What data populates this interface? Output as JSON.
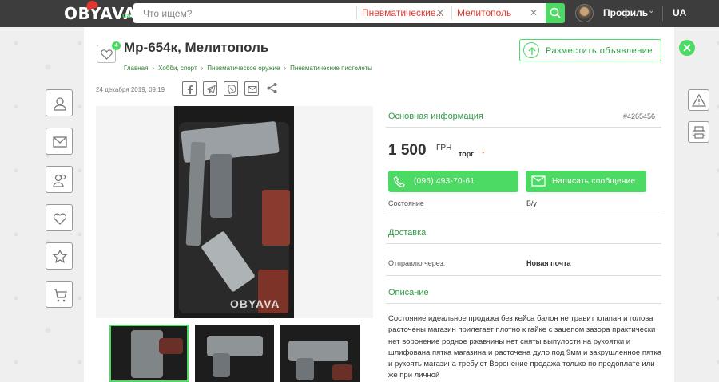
{
  "header": {
    "logo_text": "OBYAVA",
    "logo_sup": ".ua",
    "search": {
      "placeholder": "Что ищем?",
      "value": ""
    },
    "filter_category": "Пневматические...",
    "filter_city": "Мелитополь",
    "profile_label": "Профиль",
    "language": "UA"
  },
  "listing": {
    "title": "Мр-654к, Мелитополь",
    "favorites_count": "4",
    "breadcrumb": [
      "Главная",
      "Хобби, спорт",
      "Пневматическое оружие",
      "Пневматические пистолеты"
    ],
    "date": "24 декабря 2019, 09:19",
    "post_ad_label": "Разместить объявление",
    "photo_watermark": "OBYAVA"
  },
  "info": {
    "main_heading": "Основная информация",
    "ad_id": "#4265456",
    "price": "1 500",
    "currency": "ГРН",
    "trade": "торг",
    "phone": "(096) 493-70-61",
    "message_label": "Написать сообщение",
    "condition_label": "Состояние",
    "condition_value": "Б/у",
    "delivery_heading": "Доставка",
    "ship_via_label": "Отправлю через:",
    "ship_via_value": "Новая почта",
    "description_heading": "Описание",
    "description": "Состояние идеальное продажа без кейса балон не травит клапан и голова расточены магазин прилегает плотно к гайке с зацепом зазора практически нет воронение родное ржавчины нет сняты выпулости на рукоятки и шлифована пятка магазина и расточена дуло под 9мм и закрушленное пятка и рукоять магазина требуют Воронение продажа только по предоплате или же при личной"
  },
  "colors": {
    "accent": "#4cd964",
    "link_green": "#2e9c45",
    "filter_red": "#e2382f",
    "topbar": "#3d3d3d"
  },
  "icons": {
    "left_sidebar": [
      "user-icon",
      "mail-icon",
      "users-icon",
      "heart-icon",
      "star-icon",
      "cart-icon"
    ],
    "right_sidebar": [
      "warning-icon",
      "printer-icon"
    ],
    "share": [
      "facebook-icon",
      "telegram-icon",
      "viber-icon",
      "email-icon",
      "share-icon"
    ]
  }
}
